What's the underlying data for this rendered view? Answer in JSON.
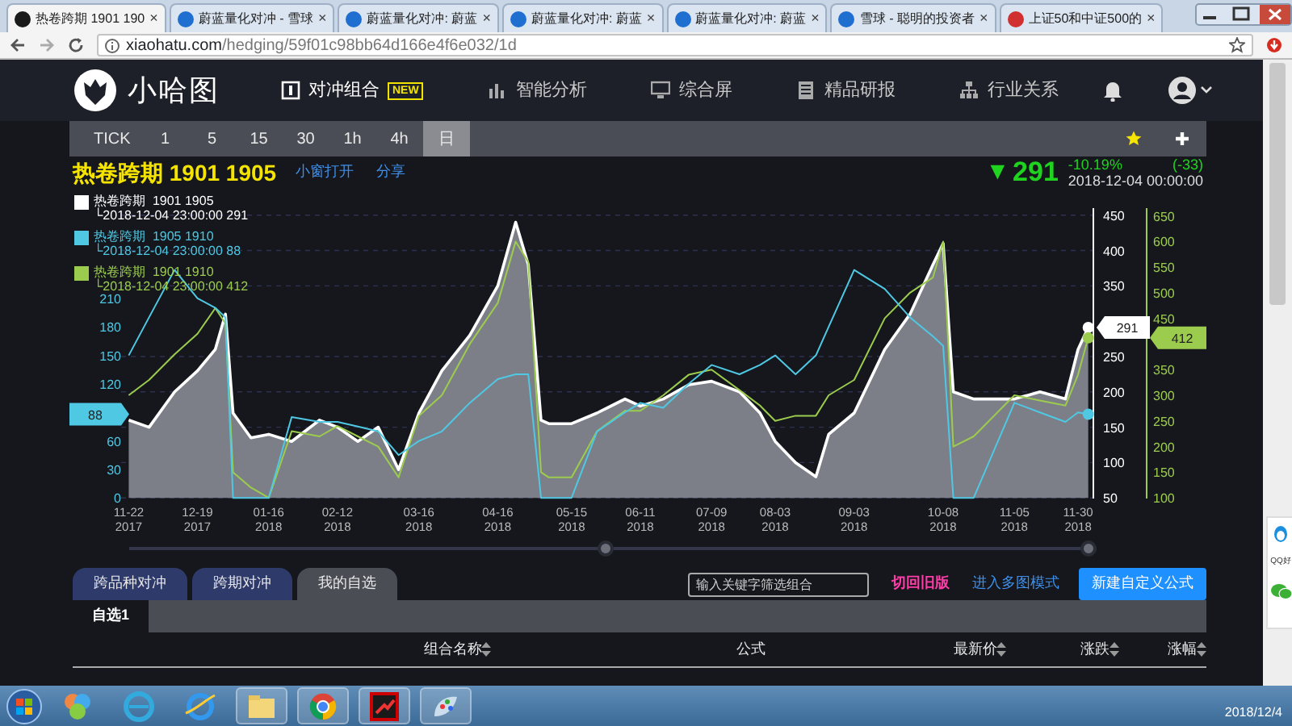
{
  "browser": {
    "tabs": [
      {
        "title": "热卷跨期 1901 190",
        "selected": true,
        "color": "#1a1a1a",
        "close": "×"
      },
      {
        "title": "蔚蓝量化对冲 - 雪球",
        "selected": false,
        "color": "#1f6fd0",
        "close": "×"
      },
      {
        "title": "蔚蓝量化对冲: 蔚蓝",
        "selected": false,
        "color": "#1f6fd0",
        "close": "×"
      },
      {
        "title": "蔚蓝量化对冲: 蔚蓝",
        "selected": false,
        "color": "#1f6fd0",
        "close": "×"
      },
      {
        "title": "蔚蓝量化对冲: 蔚蓝",
        "selected": false,
        "color": "#1f6fd0",
        "close": "×"
      },
      {
        "title": "雪球 - 聪明的投资者",
        "selected": false,
        "color": "#1f6fd0",
        "close": "×"
      },
      {
        "title": "上证50和中证500的",
        "selected": false,
        "color": "#d03030",
        "close": "×"
      }
    ],
    "address": {
      "host": "xiaohatu.com",
      "path": "/hedging/59f01c98bb64d166e4f6e032/1d"
    }
  },
  "navbar": {
    "brand": "小哈图",
    "items": [
      {
        "label": "对冲组合",
        "selected": true,
        "badge": "NEW",
        "kind": "hedge"
      },
      {
        "label": "智能分析",
        "selected": false,
        "kind": "analysis"
      },
      {
        "label": "综合屏",
        "selected": false,
        "kind": "screen"
      },
      {
        "label": "精品研报",
        "selected": false,
        "kind": "report"
      },
      {
        "label": "行业关系",
        "selected": false,
        "kind": "industry"
      }
    ]
  },
  "toolbar": {
    "periods": [
      {
        "label": "TICK",
        "selected": false
      },
      {
        "label": "1",
        "selected": false
      },
      {
        "label": "5",
        "selected": false
      },
      {
        "label": "15",
        "selected": false
      },
      {
        "label": "30",
        "selected": false
      },
      {
        "label": "1h",
        "selected": false
      },
      {
        "label": "4h",
        "selected": false
      },
      {
        "label": "日",
        "selected": true
      }
    ]
  },
  "quote": {
    "title": "热卷跨期 1901 1905",
    "links": [
      "小窗打开",
      "分享"
    ],
    "arrow": "▼",
    "price": "291",
    "change_pct": "-10.19%",
    "change": "(-33)",
    "time": "2018-12-04 00:00:00"
  },
  "chart": {
    "legend_details": [
      "└2018-12-04 23:00:00 291",
      "└2018-12-04 23:00:00 88",
      "└2018-12-04 23:00:00 412"
    ],
    "value_tags": [
      "291",
      "88",
      "412"
    ],
    "chart_data": {
      "type": "line",
      "grid": true,
      "legend": true,
      "y2ticks": [
        {
          "value": 0,
          "label": "0"
        },
        {
          "value": 30,
          "label": "30"
        },
        {
          "value": 60,
          "label": "60"
        },
        {
          "value": 120,
          "label": "120"
        },
        {
          "value": 150,
          "label": "150"
        },
        {
          "value": 180,
          "label": "180"
        },
        {
          "value": 210,
          "label": "210"
        }
      ],
      "y2lim": [
        0,
        305
      ],
      "y3ticks": [
        {
          "value": 100,
          "label": "100"
        },
        {
          "value": 150,
          "label": "150"
        },
        {
          "value": 200,
          "label": "200"
        },
        {
          "value": 250,
          "label": "250"
        },
        {
          "value": 300,
          "label": "300"
        },
        {
          "value": 350,
          "label": "350"
        },
        {
          "value": 450,
          "label": "450"
        },
        {
          "value": 500,
          "label": "500"
        },
        {
          "value": 550,
          "label": "550"
        },
        {
          "value": 600,
          "label": "600"
        },
        {
          "value": 650,
          "label": "650"
        }
      ],
      "y3lim": [
        100,
        665
      ],
      "x": [
        "2017-11-22",
        "2017-11-30",
        "2017-12-10",
        "2017-12-19",
        "2017-12-26",
        "2017-12-30",
        "2018-01-02",
        "2018-01-09",
        "2018-01-16",
        "2018-01-25",
        "2018-02-05",
        "2018-02-12",
        "2018-02-20",
        "2018-02-28",
        "2018-03-08",
        "2018-03-16",
        "2018-03-25",
        "2018-04-05",
        "2018-04-16",
        "2018-04-23",
        "2018-04-28",
        "2018-05-03",
        "2018-05-06",
        "2018-05-15",
        "2018-05-25",
        "2018-06-05",
        "2018-06-11",
        "2018-06-20",
        "2018-06-30",
        "2018-07-09",
        "2018-07-20",
        "2018-07-28",
        "2018-08-03",
        "2018-08-11",
        "2018-08-19",
        "2018-08-24",
        "2018-09-03",
        "2018-09-15",
        "2018-09-25",
        "2018-10-04",
        "2018-10-08",
        "2018-10-12",
        "2018-10-20",
        "2018-11-05",
        "2018-11-15",
        "2018-11-25",
        "2018-11-30",
        "2018-12-04"
      ],
      "xlim": [
        "2017-11-19",
        "2018-12-06"
      ],
      "ylim": [
        50,
        460
      ],
      "xticks": [
        {
          "value": "2017-11-22",
          "label": "11-22 2017"
        },
        {
          "value": "2017-12-19",
          "label": "12-19 2017"
        },
        {
          "value": "2018-01-16",
          "label": "01-16 2018"
        },
        {
          "value": "2018-02-12",
          "label": "02-12 2018"
        },
        {
          "value": "2018-03-16",
          "label": "03-16 2018"
        },
        {
          "value": "2018-04-16",
          "label": "04-16 2018"
        },
        {
          "value": "2018-05-15",
          "label": "05-15 2018"
        },
        {
          "value": "2018-06-11",
          "label": "06-11 2018"
        },
        {
          "value": "2018-07-09",
          "label": "07-09 2018"
        },
        {
          "value": "2018-08-03",
          "label": "08-03 2018"
        },
        {
          "value": "2018-09-03",
          "label": "09-03 2018"
        },
        {
          "value": "2018-10-08",
          "label": "10-08 2018"
        },
        {
          "value": "2018-11-05",
          "label": "11-05 2018"
        },
        {
          "value": "2018-11-30",
          "label": "11-30 2018"
        }
      ],
      "yticks": [
        50,
        100,
        150,
        200,
        250,
        350,
        400,
        450
      ],
      "series": [
        {
          "name": "热卷跨期  1901 1905",
          "color": "#ffffff",
          "type": "area",
          "values": [
            160,
            150,
            200,
            230,
            260,
            310,
            170,
            135,
            140,
            130,
            160,
            150,
            130,
            150,
            90,
            170,
            230,
            280,
            350,
            440,
            380,
            160,
            155,
            155,
            170,
            190,
            180,
            190,
            210,
            215,
            200,
            170,
            130,
            100,
            80,
            140,
            170,
            260,
            310,
            380,
            410,
            200,
            190,
            190,
            200,
            190,
            260,
            291
          ]
        },
        {
          "name": "热卷跨期  1905 1910",
          "color": "#4fc8e3",
          "axis": "y2",
          "values": [
            150,
            190,
            240,
            210,
            200,
            190,
            0,
            0,
            0,
            85,
            80,
            80,
            75,
            70,
            45,
            60,
            70,
            100,
            125,
            130,
            130,
            0,
            0,
            0,
            70,
            90,
            100,
            95,
            120,
            140,
            130,
            140,
            150,
            130,
            150,
            180,
            240,
            220,
            190,
            170,
            160,
            0,
            0,
            100,
            90,
            80,
            90,
            88
          ]
        },
        {
          "name": "热卷跨期  1901 1910",
          "color": "#9ccc4e",
          "axis": "y3",
          "values": [
            300,
            330,
            380,
            420,
            470,
            440,
            150,
            120,
            100,
            230,
            220,
            240,
            220,
            200,
            140,
            260,
            300,
            400,
            480,
            600,
            560,
            150,
            140,
            140,
            230,
            270,
            270,
            300,
            340,
            350,
            310,
            280,
            250,
            260,
            260,
            300,
            330,
            450,
            500,
            530,
            600,
            200,
            220,
            300,
            290,
            280,
            340,
            412
          ]
        }
      ]
    }
  },
  "lists": {
    "tabs": [
      {
        "label": "跨品种对冲",
        "selected": false
      },
      {
        "label": "跨期对冲",
        "selected": false
      },
      {
        "label": "我的自选",
        "selected": true
      }
    ],
    "search": {
      "placeholder": "输入关键字筛选组合"
    },
    "links": [
      {
        "label": "切回旧版",
        "kind": "old"
      },
      {
        "label": "进入多图模式",
        "kind": "mode"
      }
    ],
    "button": "新建自定义公式",
    "subtabs": [
      {
        "label": "自选1",
        "selected": true
      }
    ],
    "columns": [
      {
        "label": "组合名称",
        "sortable": true
      },
      {
        "label": "公式",
        "sortable": false
      },
      {
        "label": "最新价",
        "sortable": true
      },
      {
        "label": "涨跌",
        "sortable": true
      },
      {
        "label": "涨幅",
        "sortable": true
      }
    ]
  },
  "side_widget": {
    "label": "QQ好"
  },
  "taskbar": {
    "date": "2018/12/4"
  }
}
